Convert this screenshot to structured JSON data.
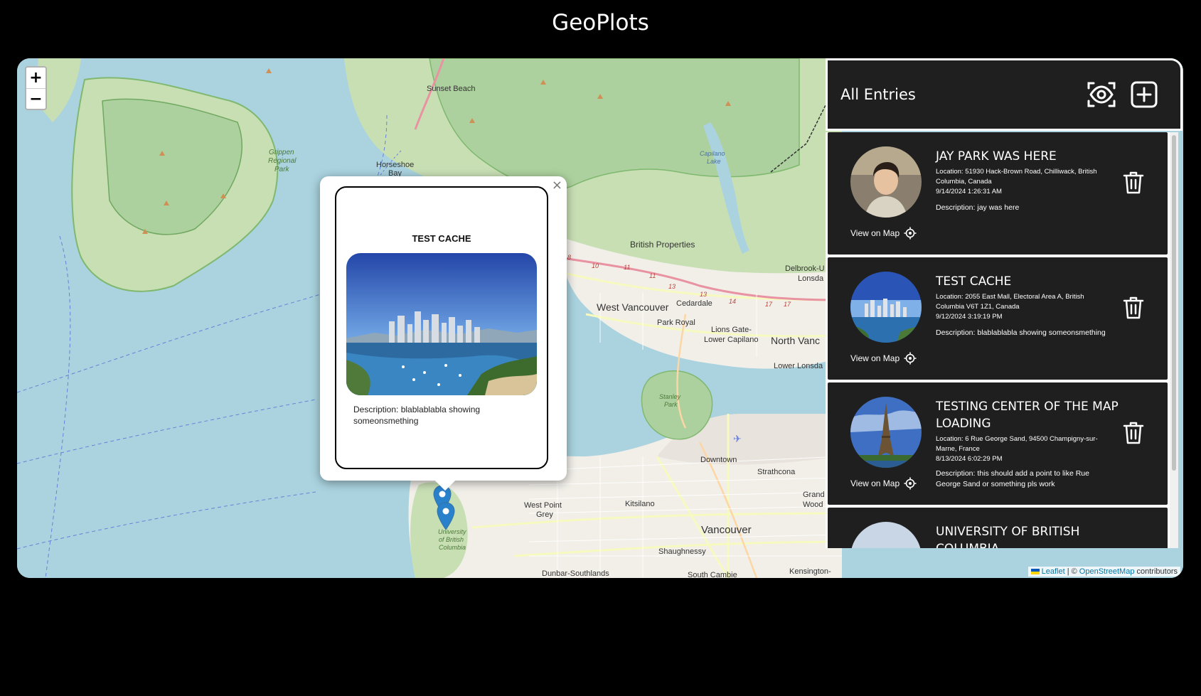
{
  "app": {
    "title": "GeoPlots"
  },
  "map": {
    "zoom_in": "+",
    "zoom_out": "−",
    "labels": [
      {
        "text": "Sunset Beach",
        "cls": "sm"
      },
      {
        "text": "Horseshoe",
        "cls": "sm"
      },
      {
        "text": "Bay",
        "cls": "sm"
      },
      {
        "text": "Grippen",
        "cls": "park"
      },
      {
        "text": "Regional",
        "cls": "park"
      },
      {
        "text": "Park",
        "cls": "park"
      },
      {
        "text": "Capilano",
        "cls": "water"
      },
      {
        "text": "Lake",
        "cls": "water"
      },
      {
        "text": "British Properties",
        "cls": "sm"
      },
      {
        "text": "Delbrook-U",
        "cls": "sm"
      },
      {
        "text": "Lonsda",
        "cls": "sm"
      },
      {
        "text": "West Vancouver",
        "cls": "lg"
      },
      {
        "text": "Cedardale",
        "cls": "sm"
      },
      {
        "text": "Park Royal",
        "cls": "sm"
      },
      {
        "text": "Lions Gate-",
        "cls": "sm"
      },
      {
        "text": "Lower Capilano",
        "cls": "sm"
      },
      {
        "text": "North Vanc",
        "cls": "lg"
      },
      {
        "text": "Lower Lonsda",
        "cls": "sm"
      },
      {
        "text": "Stanley",
        "cls": "park"
      },
      {
        "text": "Park",
        "cls": "park"
      },
      {
        "text": "Downtown",
        "cls": "sm"
      },
      {
        "text": "Strathcona",
        "cls": "sm"
      },
      {
        "text": "Grand",
        "cls": "sm"
      },
      {
        "text": "Wood",
        "cls": "sm"
      },
      {
        "text": "West Point",
        "cls": "sm"
      },
      {
        "text": "Grey",
        "cls": "sm"
      },
      {
        "text": "Kitsilano",
        "cls": "sm"
      },
      {
        "text": "Vancouver",
        "cls": "xl"
      },
      {
        "text": "Shaughnessy",
        "cls": "sm"
      },
      {
        "text": "Dunbar-Southlands",
        "cls": "sm"
      },
      {
        "text": "South Cambie",
        "cls": "sm"
      },
      {
        "text": "Kensington-",
        "cls": "sm"
      },
      {
        "text": "University",
        "cls": "park"
      },
      {
        "text": "of British",
        "cls": "park"
      },
      {
        "text": "Columbia",
        "cls": "park"
      }
    ],
    "route_numbers": [
      "8",
      "10",
      "11",
      "11",
      "13",
      "13",
      "14",
      "17",
      "17"
    ],
    "attribution": {
      "leaflet": "Leaflet",
      "separator": "| ©",
      "osm": "OpenStreetMap",
      "suffix": "contributors"
    }
  },
  "popup": {
    "close": "×",
    "title": "TEST CACHE",
    "description": "Description: blablablabla showing someonsmething"
  },
  "panel": {
    "title": "All Entries",
    "toggle_icon": "eye-icon",
    "add_icon": "plus-square-icon",
    "view_on_map_label": "View on Map",
    "entries": [
      {
        "title": "JAY PARK WAS HERE",
        "location": "Location: 51930 Hack-Brown Road, Chilliwack, British Columbia, Canada",
        "date": "9/14/2024 1:26:31 AM",
        "description": "Description: jay was here",
        "image": "portrait"
      },
      {
        "title": "TEST CACHE",
        "location": "Location: 2055 East Mall, Electoral Area A, British Columbia V6T 1Z1, Canada",
        "date": "9/12/2024 3:19:19 PM",
        "description": "Description: blablablabla showing someonsmething",
        "image": "city-skyline"
      },
      {
        "title": "TESTING CENTER OF THE MAP LOADING",
        "location": "Location: 6 Rue George Sand, 94500 Champigny-sur-Marne, France",
        "date": "8/13/2024 6:02:29 PM",
        "description": "Description: this should add a point to like Rue George Sand or something pls work",
        "image": "eiffel-tower"
      },
      {
        "title": "UNIVERSITY OF BRITISH COLUMBIA",
        "location": "",
        "date": "",
        "description": "",
        "image": "campus"
      }
    ]
  },
  "colors": {
    "background": "#000000",
    "panel": "#1f1f1f",
    "water": "#aad3df",
    "land": "#f2efe9",
    "park": "#add19e",
    "marker": "#2a81cb"
  }
}
